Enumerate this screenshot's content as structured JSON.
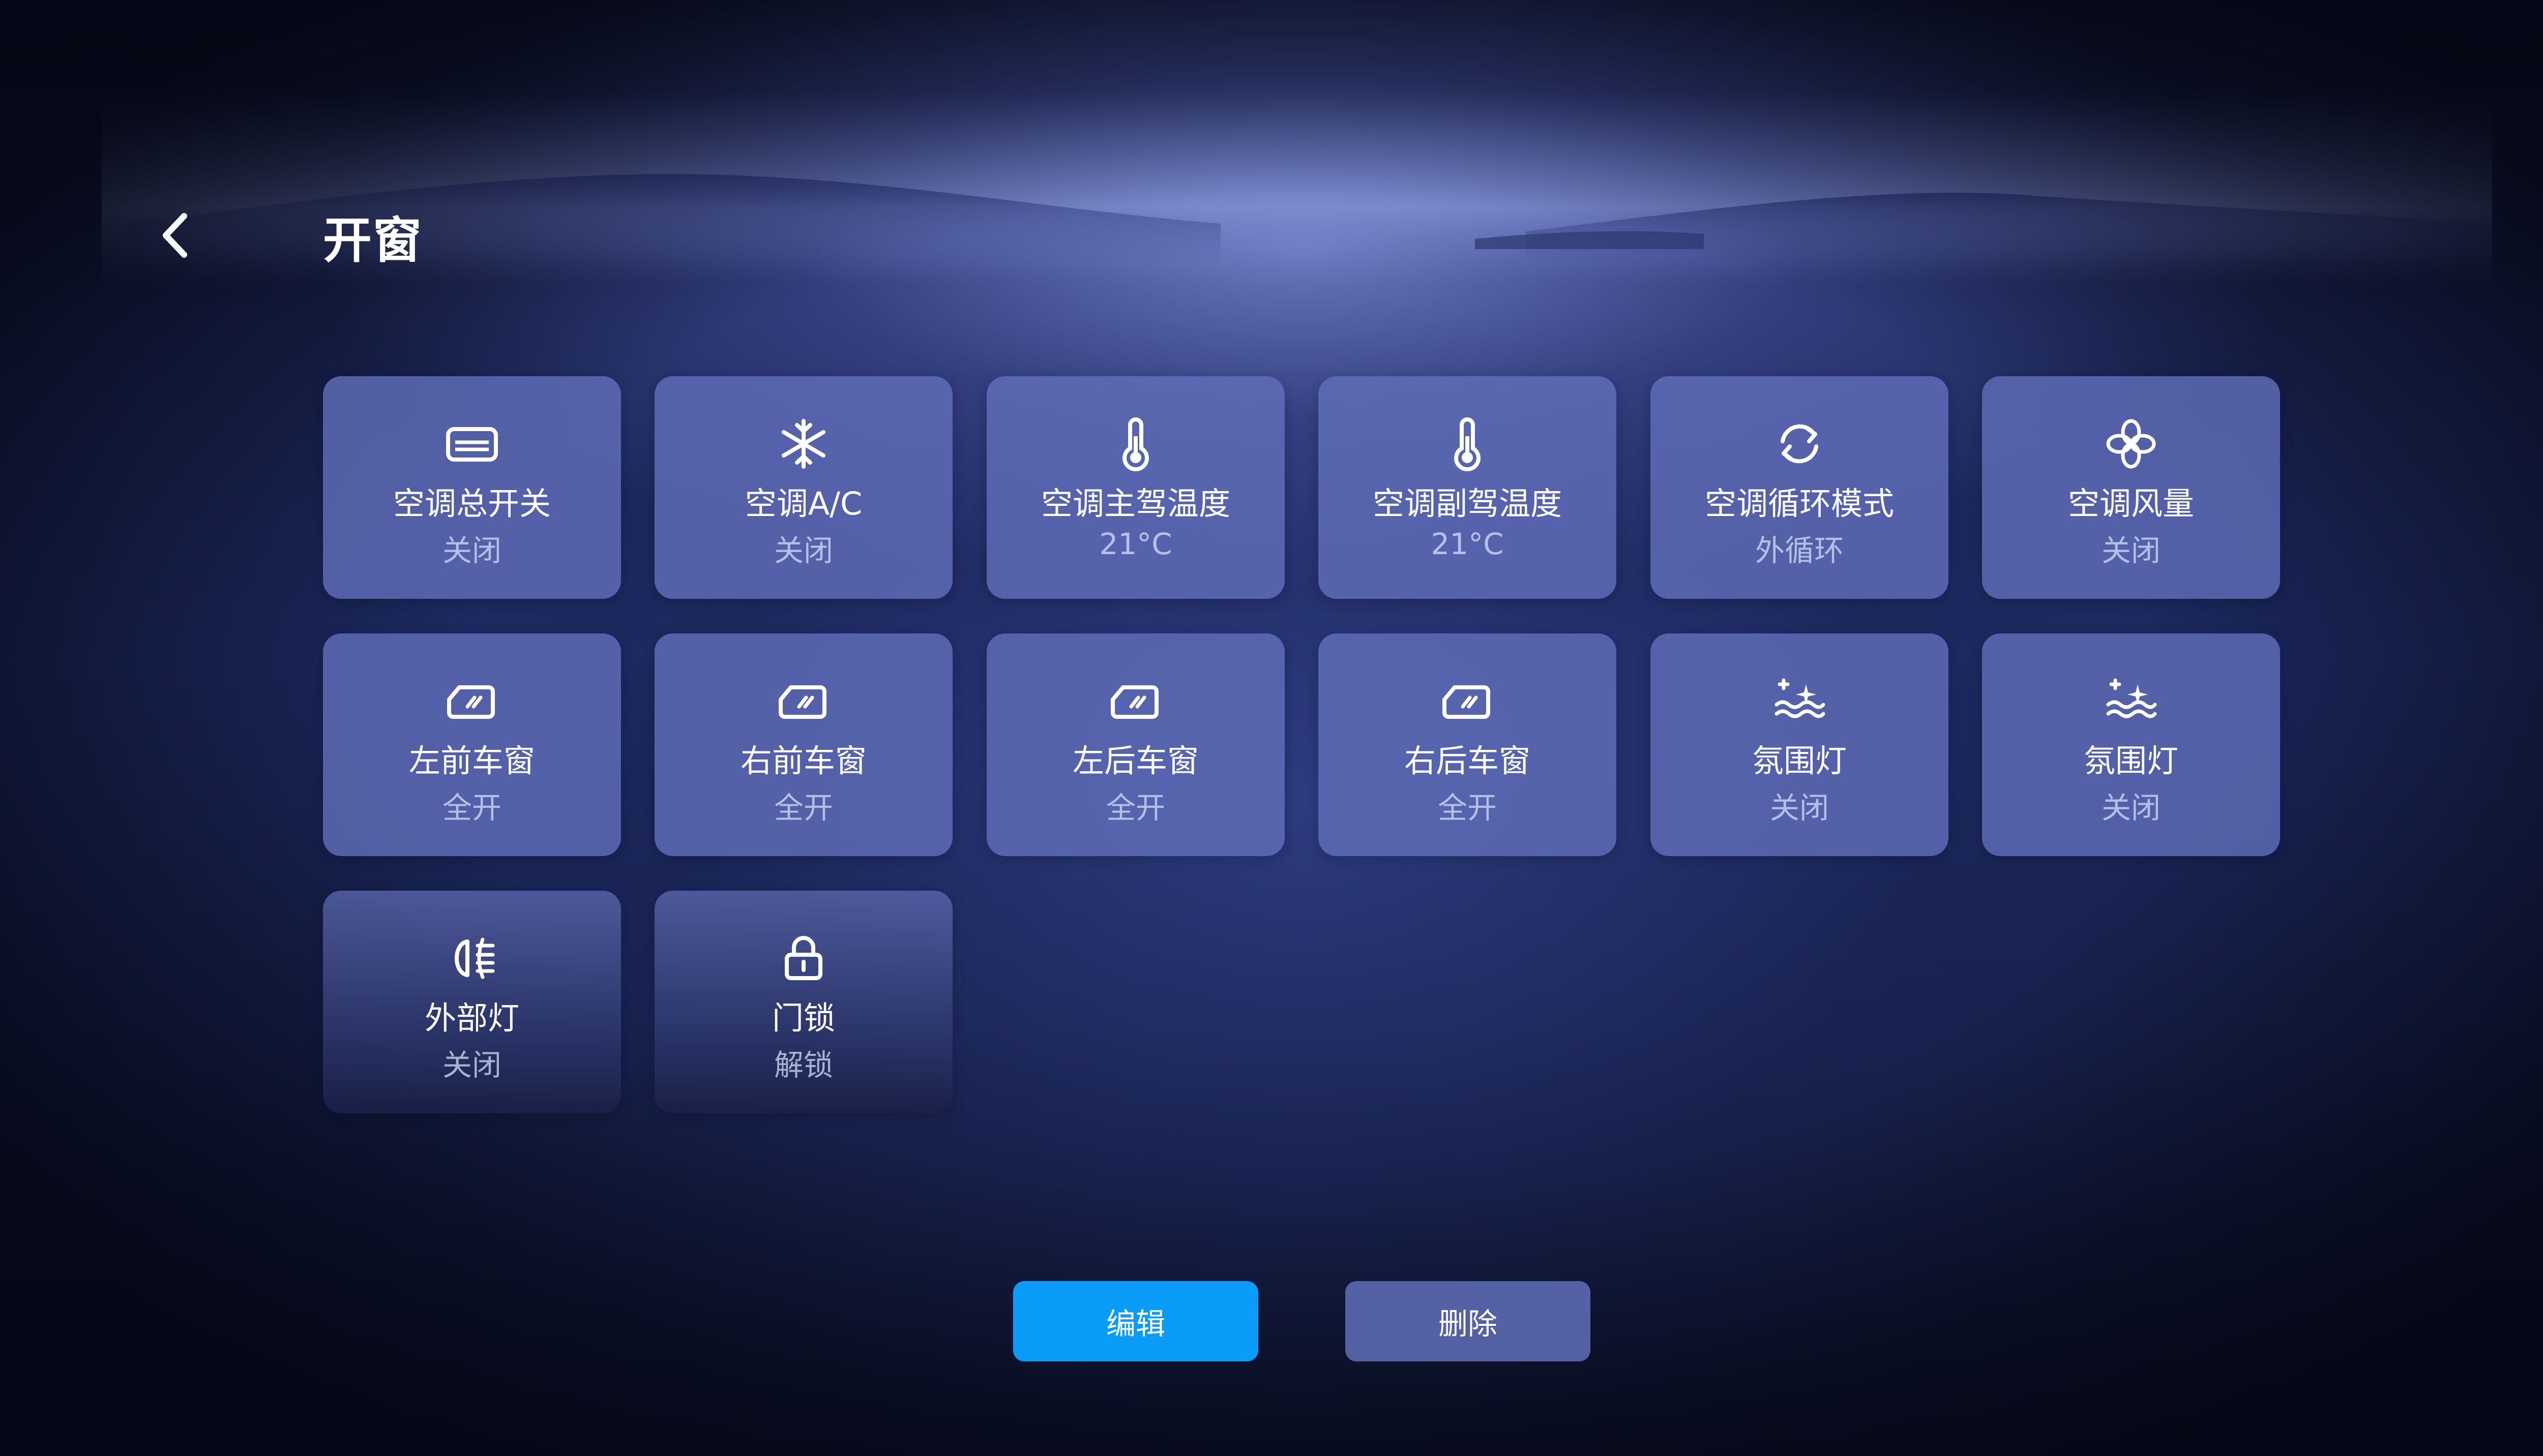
{
  "header": {
    "title": "开窗",
    "back_icon": "chevron-left-icon"
  },
  "tiles": [
    {
      "icon": "ac-unit-icon",
      "label": "空调总开关",
      "value": "关闭"
    },
    {
      "icon": "snowflake-icon",
      "label": "空调A/C",
      "value": "关闭"
    },
    {
      "icon": "thermometer-icon",
      "label": "空调主驾温度",
      "value": "21°C"
    },
    {
      "icon": "thermometer-icon",
      "label": "空调副驾温度",
      "value": "21°C"
    },
    {
      "icon": "recirculation-icon",
      "label": "空调循环模式",
      "value": "外循环"
    },
    {
      "icon": "fan-icon",
      "label": "空调风量",
      "value": "关闭"
    },
    {
      "icon": "window-icon",
      "label": "左前车窗",
      "value": "全开"
    },
    {
      "icon": "window-icon",
      "label": "右前车窗",
      "value": "全开"
    },
    {
      "icon": "window-icon",
      "label": "左后车窗",
      "value": "全开"
    },
    {
      "icon": "window-icon",
      "label": "右后车窗",
      "value": "全开"
    },
    {
      "icon": "ambient-light-icon",
      "label": "氛围灯",
      "value": "关闭"
    },
    {
      "icon": "ambient-light-icon",
      "label": "氛围灯",
      "value": "关闭"
    },
    {
      "icon": "fog-light-icon",
      "label": "外部灯",
      "value": "关闭"
    },
    {
      "icon": "lock-icon",
      "label": "门锁",
      "value": "解锁"
    }
  ],
  "actions": {
    "edit_label": "编辑",
    "delete_label": "删除"
  },
  "colors": {
    "primary_button": "#0a9cf8",
    "tile": "#606eb9",
    "background": "#1d2a62"
  }
}
